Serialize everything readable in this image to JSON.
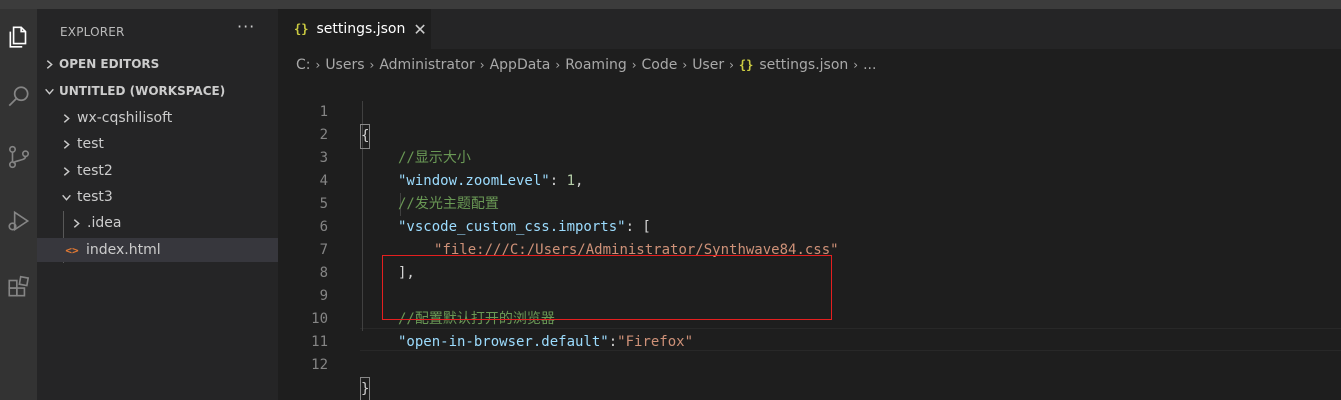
{
  "sidebar": {
    "title": "EXPLORER",
    "more": "···",
    "sections": {
      "open_editors": "OPEN EDITORS",
      "workspace": "UNTITLED (WORKSPACE)"
    },
    "items": [
      {
        "label": "wx-cqshilisoft"
      },
      {
        "label": "test"
      },
      {
        "label": "test2"
      },
      {
        "label": "test3"
      },
      {
        "label": ".idea"
      },
      {
        "label": "index.html"
      }
    ],
    "html_icon": "<>"
  },
  "tab": {
    "icon": "{}",
    "label": "settings.json",
    "close": "✕"
  },
  "breadcrumb": {
    "parts": [
      "C:",
      "Users",
      "Administrator",
      "AppData",
      "Roaming",
      "Code",
      "User"
    ],
    "file_icon": "{}",
    "file": "settings.json",
    "tail": "..."
  },
  "code": {
    "line_numbers": [
      "1",
      "2",
      "3",
      "4",
      "5",
      "6",
      "7",
      "8",
      "9",
      "10",
      "11",
      "12"
    ],
    "l1": "{",
    "l2": "//显示大小",
    "l3_key": "\"window.zoomLevel\"",
    "l3_colon": ": ",
    "l3_val": "1",
    "l3_end": ",",
    "l4": "//发光主题配置",
    "l5_key": "\"vscode_custom_css.imports\"",
    "l5_rest": ": [",
    "l6_q1": "\"",
    "l6_url": "file:///C:/Users/Administrator/Synthwave84.css",
    "l6_q2": "\"",
    "l7": "],",
    "l9": "//配置默认打开的浏览器",
    "l10_key": "\"open-in-browser.default\"",
    "l10_colon": ":",
    "l10_val": "\"Firefox\"",
    "l12": "}"
  }
}
